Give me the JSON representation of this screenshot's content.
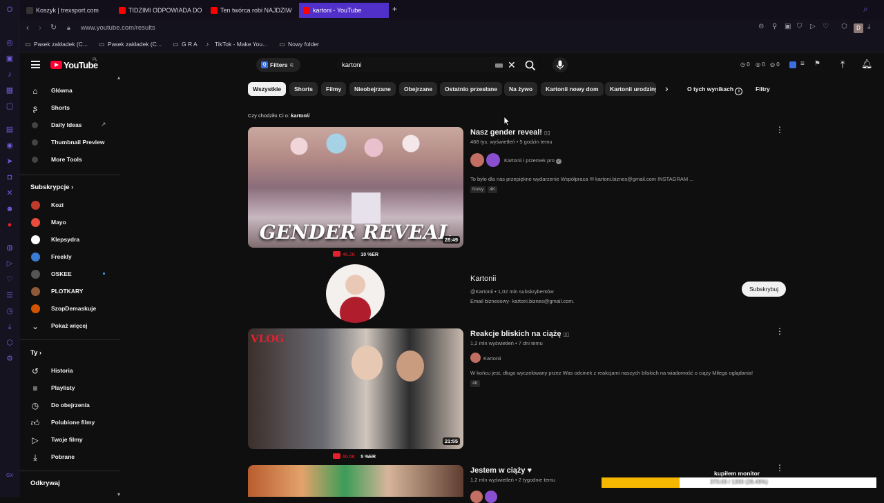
{
  "browser": {
    "tabs": [
      {
        "label": "Koszyk | trexsport.com",
        "favicon_color": "#333333"
      },
      {
        "label": "TIDZIMI ODPOWIADA DO",
        "favicon_color": "#ff0000"
      },
      {
        "label": "Ten twórca robi NAJDZIW",
        "favicon_color": "#ff0000"
      },
      {
        "label": "kartoni - YouTube",
        "favicon_color": "#ff0000"
      }
    ],
    "new_tab": "+",
    "url": "www.youtube.com/results",
    "bookmarks": [
      "Pasek zakładek (C...",
      "Pasek zakładek (C...",
      "G R A",
      "TikTok - Make You...",
      "Nowy folder"
    ],
    "profile_letter": "D"
  },
  "youtube": {
    "logo_text": "YouTube",
    "logo_country": "PL",
    "filters_label": "Filters",
    "search_value": "kartoni",
    "header_stats": [
      "0",
      "0",
      "0"
    ],
    "chips": [
      "Wszystkie",
      "Shorts",
      "Filmy",
      "Nieobejrzane",
      "Obejrzane",
      "Ostatnio przesłane",
      "Na żywo",
      "Kartonii nowy dom",
      "Kartonii urodziny"
    ],
    "about_results": "O tych wynikach",
    "filters_right": "Filtry",
    "did_you_mean_prefix": "Czy chodziło Ci o:",
    "did_you_mean_term": "kartonii"
  },
  "sidebar": {
    "main": [
      {
        "label": "Główna",
        "icon": "home-icon"
      },
      {
        "label": "Shorts",
        "icon": "shorts-icon"
      },
      {
        "label": "Daily Ideas",
        "icon": "extension-icon"
      },
      {
        "label": "Thumbnail Preview",
        "icon": "extension-icon"
      },
      {
        "label": "More Tools",
        "icon": "extension-icon"
      }
    ],
    "subs_heading": "Subskrypcje",
    "subs": [
      {
        "label": "Kozi",
        "color": "#c0392b"
      },
      {
        "label": "Mayo",
        "color": "#e74c3c"
      },
      {
        "label": "Klepsydra",
        "color": "#ffffff"
      },
      {
        "label": "Freekly",
        "color": "#3a7bd5"
      },
      {
        "label": "OSKEE",
        "color": "#555555"
      },
      {
        "label": "PLOTKARY",
        "color": "#8e5a3a"
      },
      {
        "label": "SzopDemaskuje",
        "color": "#d35400"
      }
    ],
    "show_more": "Pokaż więcej",
    "you_heading": "Ty",
    "you": [
      {
        "label": "Historia",
        "icon": "history-icon"
      },
      {
        "label": "Playlisty",
        "icon": "playlist-icon"
      },
      {
        "label": "Do obejrzenia",
        "icon": "clock-icon"
      },
      {
        "label": "Polubione filmy",
        "icon": "like-icon"
      },
      {
        "label": "Twoje filmy",
        "icon": "video-icon"
      },
      {
        "label": "Pobrane",
        "icon": "download-icon"
      }
    ],
    "explore_heading": "Odkrywaj"
  },
  "results": [
    {
      "title": "Nasz gender reveal! ",
      "meta": "468 tys. wyświetleń • 5 godzin temu",
      "channel": "Kartonii i przemek pro",
      "description": "To było dla nas przepiękne wydarzenie Współpraca ✉ kartoni.biznes@gmail.com INSTAGRAM ...",
      "badges": [
        "Nowy",
        "4K"
      ],
      "duration": "28:49",
      "thumb_text": "GENDER REVEAL",
      "stat_views": "46.2K",
      "stat_er": "10 %ER"
    },
    {
      "title": "Reakcje bliskich na ciążę ",
      "meta": "1,2 mln wyświetleń • 7 dni temu",
      "channel": "Kartonii",
      "description": "W końcu jest, długo wyczekiwany przez Was odcinek z reakcjami naszych bliskich na wiadomość o ciąży Miłego oglądania!",
      "badges": [
        "4K"
      ],
      "duration": "21:55",
      "thumb_text": "VLOG",
      "stat_views": "66.6K",
      "stat_er": "5 %ER"
    },
    {
      "title": "Jestem w ciąży ♥",
      "meta": "1,2 mln wyświetleń • 2 tygodnie temu"
    }
  ],
  "channel_card": {
    "name": "Kartonii",
    "meta": "@Kartonii • 1,02 mln subskrybentów",
    "email": "Email biznesowy- kartoni.biznes@gmail.com.",
    "subscribe_label": "Subskrybuj"
  },
  "overlay": {
    "title": "kupiłem monitor",
    "progress_text": "370.00 / 1300 (28.46%)",
    "progress_fraction": 0.2846,
    "bar_color": "#f5b700"
  }
}
